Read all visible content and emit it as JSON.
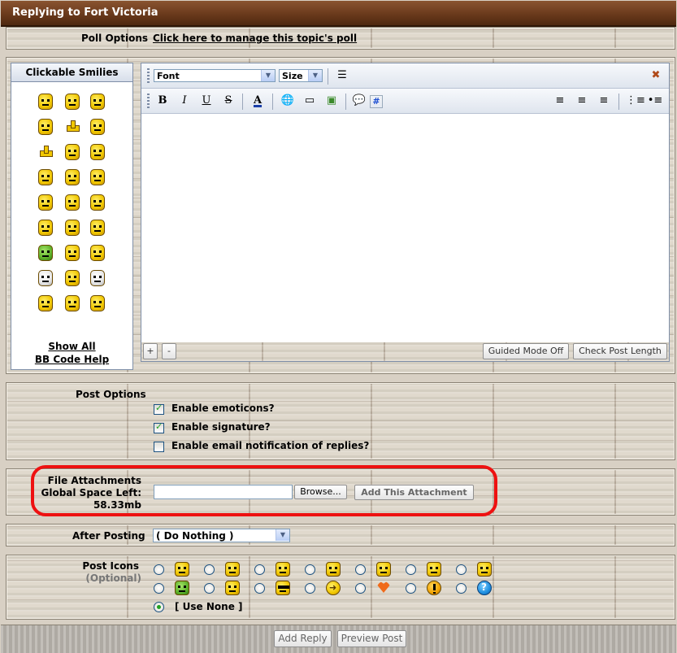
{
  "title": "Replying to Fort Victoria",
  "poll": {
    "label": "Poll Options",
    "link": "Click here to manage this topic's poll"
  },
  "smilies": {
    "header": "Clickable Smilies",
    "show_all": "Show All",
    "bbcode_help": "BB Code Help"
  },
  "editor": {
    "font_select": "Font",
    "size_select": "Size",
    "guided_mode": "Guided Mode Off",
    "check_length": "Check Post Length",
    "plus": "+",
    "minus": "-",
    "bold": "B",
    "italic": "I",
    "underline": "U",
    "strike": "S",
    "color": "A",
    "quote_icon": "#",
    "body": ""
  },
  "post_options": {
    "label": "Post Options",
    "options": [
      {
        "label": "Enable emoticons?",
        "checked": true
      },
      {
        "label": "Enable signature?",
        "checked": true
      },
      {
        "label": "Enable email notification of replies?",
        "checked": false
      }
    ]
  },
  "attachments": {
    "label": "File Attachments",
    "space_label": "Global Space Left:",
    "space_value": "58.33mb",
    "browse": "Browse...",
    "add": "Add This Attachment"
  },
  "after_posting": {
    "label": "After Posting",
    "value": "( Do Nothing )"
  },
  "post_icons": {
    "label": "Post Icons",
    "optional": "(Optional)",
    "use_none": "[ Use None ]"
  },
  "footer": {
    "add_reply": "Add Reply",
    "preview": "Preview Post"
  }
}
